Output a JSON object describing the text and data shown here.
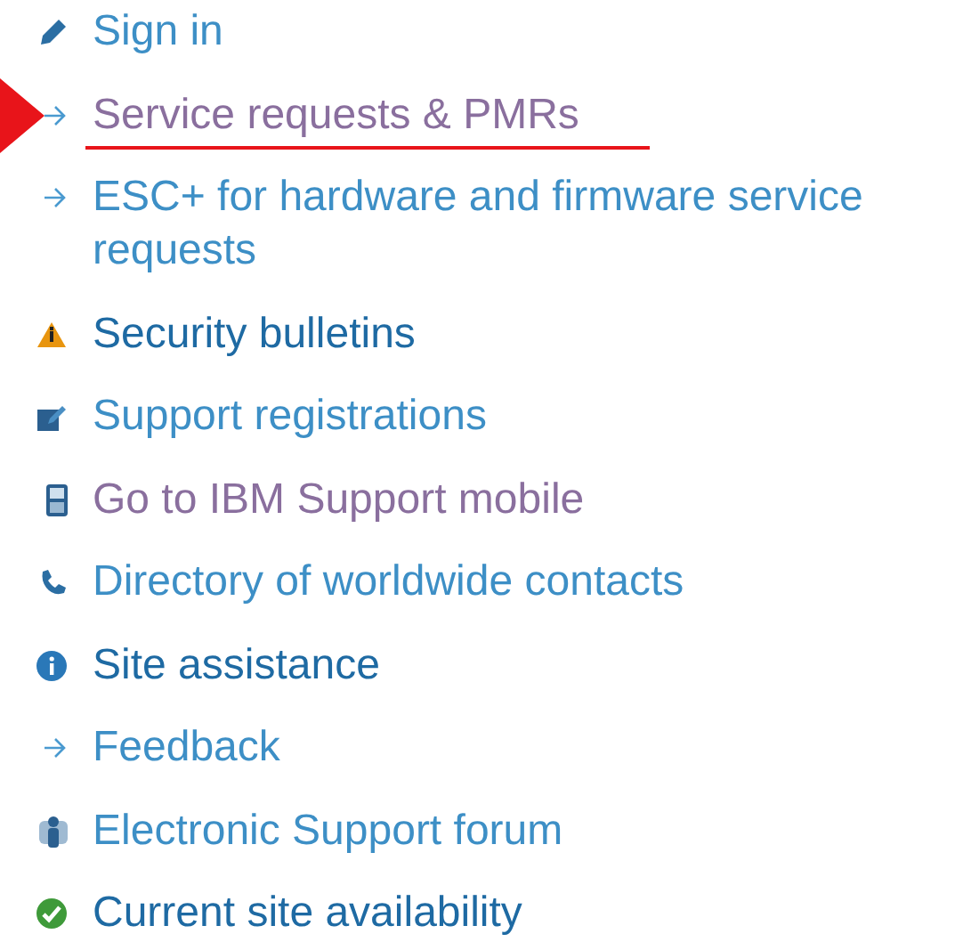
{
  "links": [
    {
      "label": "Sign in",
      "kind": "pencil",
      "color": "#3d8fc6",
      "highlighted": false
    },
    {
      "label": "Service requests & PMRs",
      "kind": "arrow",
      "color": "#8a6f9e",
      "highlighted": true
    },
    {
      "label": "ESC+ for hardware and firmware service requests",
      "kind": "arrow",
      "color": "#3d8fc6",
      "highlighted": false
    },
    {
      "label": "Security bulletins",
      "kind": "warning",
      "color": "#1e6aa3",
      "highlighted": false
    },
    {
      "label": "Support registrations",
      "kind": "edit",
      "color": "#3d8fc6",
      "highlighted": false
    },
    {
      "label": "Go to IBM Support mobile",
      "kind": "mobile",
      "color": "#8a6f9e",
      "highlighted": false
    },
    {
      "label": "Directory of worldwide contacts",
      "kind": "phone",
      "color": "#3d8fc6",
      "highlighted": false
    },
    {
      "label": "Site assistance",
      "kind": "info",
      "color": "#1e6aa3",
      "highlighted": false
    },
    {
      "label": "Feedback",
      "kind": "arrow",
      "color": "#3d8fc6",
      "highlighted": false
    },
    {
      "label": "Electronic Support forum",
      "kind": "person",
      "color": "#3d8fc6",
      "highlighted": false
    },
    {
      "label": "Current site availability",
      "kind": "check",
      "color": "#1e6aa3",
      "highlighted": false
    }
  ]
}
